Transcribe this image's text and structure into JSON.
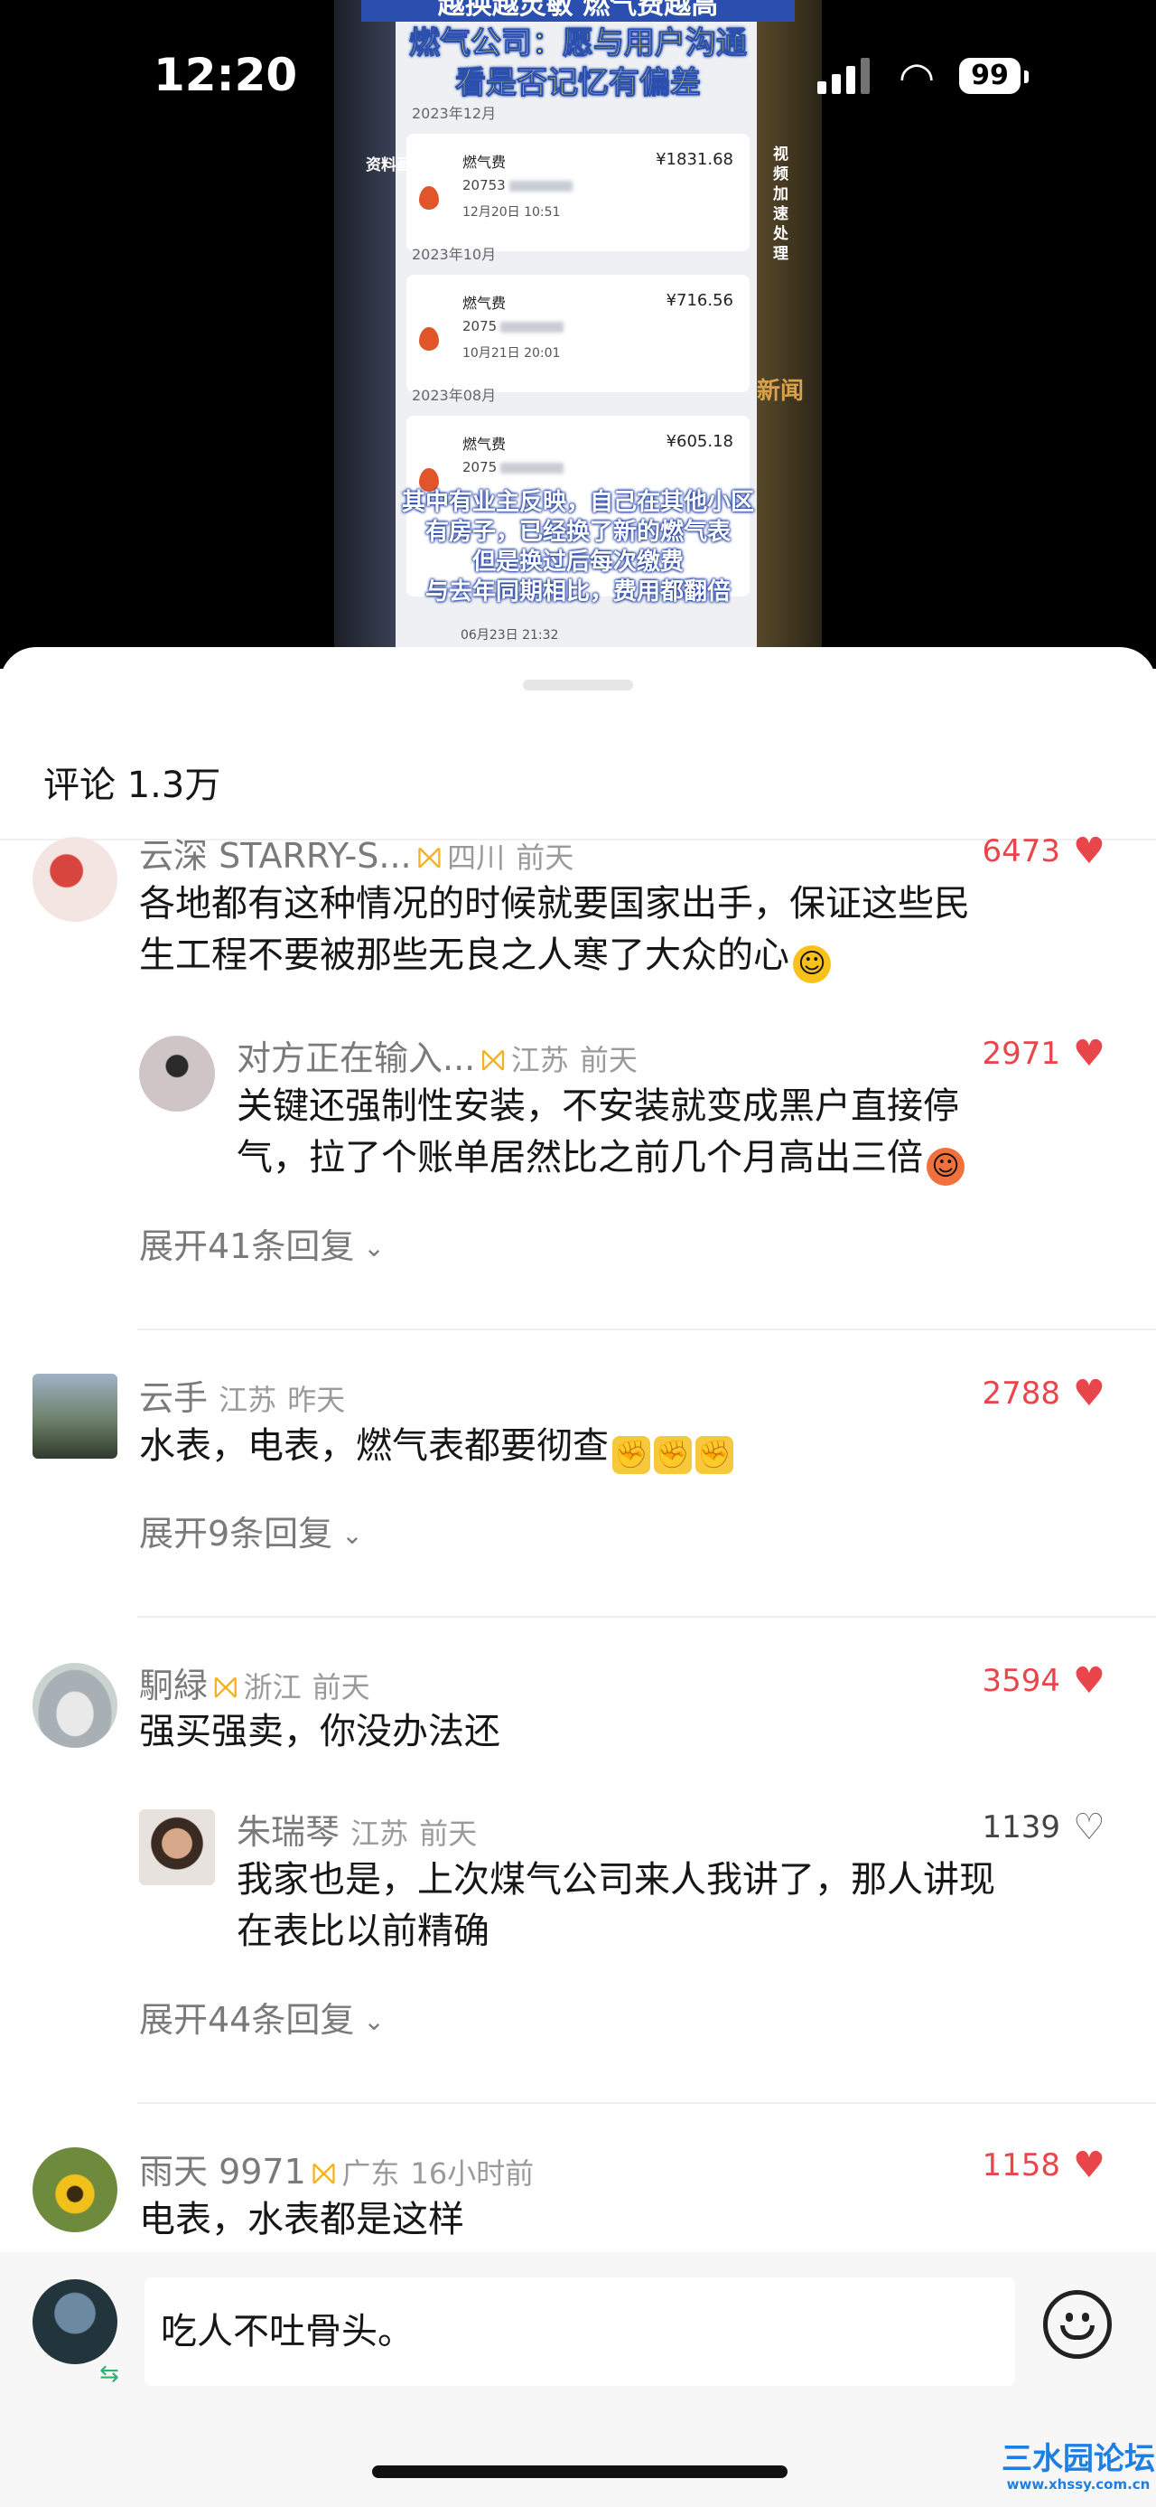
{
  "status_bar": {
    "time": "12:20",
    "battery": "99"
  },
  "video": {
    "top_caption": "越换越灵敏 燃气费越高",
    "title_line1": "燃气公司：愿与用户沟通",
    "title_line2": "看是否记忆有偏差",
    "side_tag": "资料画面",
    "side_vertical": "视频加速处理",
    "news_tag": "新闻",
    "bills": [
      {
        "month": "2023年12月",
        "name": "燃气费",
        "amount": "¥1831.68",
        "account": "20753",
        "time": "12月20日 10:51"
      },
      {
        "month": "2023年10月",
        "name": "燃气费",
        "amount": "¥716.56",
        "account": "2075",
        "time": "10月21日 20:01"
      },
      {
        "month": "2023年08月",
        "name": "燃气费",
        "amount": "¥605.18",
        "account": "2075",
        "time": ""
      }
    ],
    "bottom_time": "06月23日 21:32",
    "subtitle": [
      "其中有业主反映，自己在其他小区",
      "有房子，已经换了新的燃气表",
      "但是换过后每次缴费",
      "与去年同期相比，费用都翻倍"
    ]
  },
  "comments_header": {
    "title": "评论 1.3万"
  },
  "comments": [
    {
      "user": "云深 STARRY-S...",
      "location": "四川",
      "time": "前天",
      "likes": "6473",
      "text_line1": "各地都有这种情况的时候就要国家出手，保证这些民",
      "text_line2": "生工程不要被那些无良之人寒了大众的心",
      "reply": {
        "user": "对方正在输入...",
        "location": "江苏",
        "time": "前天",
        "likes": "2971",
        "text_line1": "关键还强制性安装，不安装就变成黑户直接停",
        "text_line2": "气，拉了个账单居然比之前几个月高出三倍"
      },
      "expand": "展开41条回复"
    },
    {
      "user": "云手",
      "location": "江苏",
      "time": "昨天",
      "likes": "2788",
      "text": "水表，电表，燃气表都要彻查",
      "expand": "展开9条回复"
    },
    {
      "user": "駉緑",
      "location": "浙江",
      "time": "前天",
      "likes": "3594",
      "text": "强买强卖，你没办法还",
      "reply": {
        "user": "朱瑞琴",
        "location": "江苏",
        "time": "前天",
        "likes": "1139",
        "text_line1": "我家也是，上次煤气公司来人我讲了，那人讲现",
        "text_line2": "在表比以前精确"
      },
      "expand": "展开44条回复"
    },
    {
      "user": "雨天 9971",
      "location": "广东",
      "time": "16小时前",
      "likes": "1158",
      "text": "电表，水表都是这样"
    }
  ],
  "input": {
    "value": "吃人不吐骨头。"
  },
  "watermark": {
    "line1": "三水园论坛",
    "line2": "www.xhssy.com.cn"
  },
  "colors": {
    "like_red": "#e8464a",
    "badge_gold": "#f5b21e"
  }
}
